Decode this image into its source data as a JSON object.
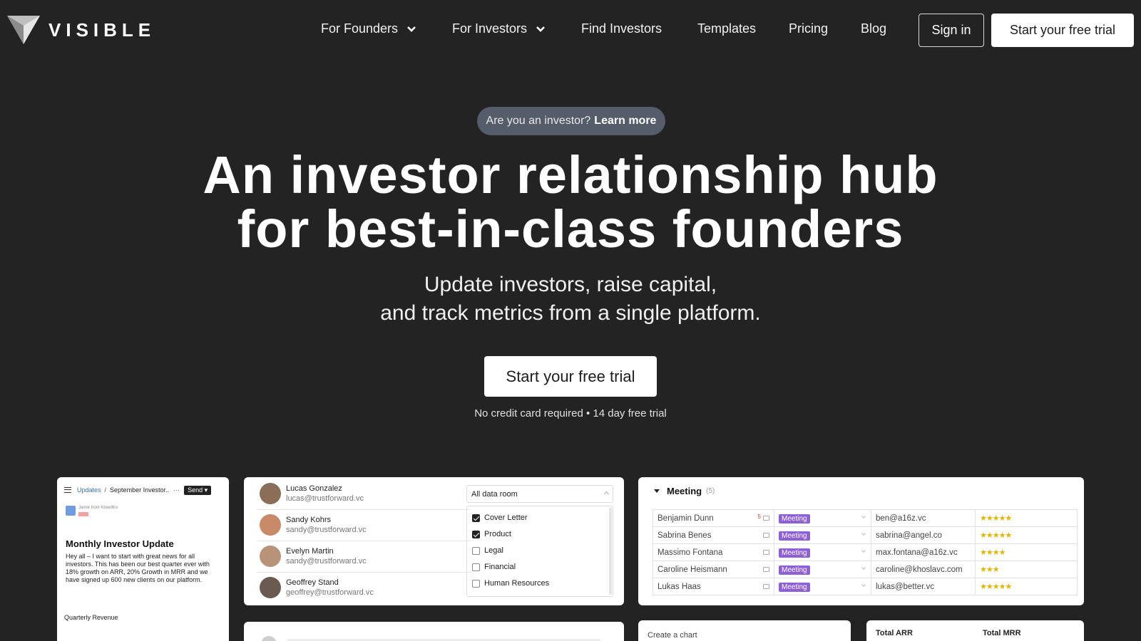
{
  "nav": {
    "logo_text": "VISIBLE",
    "links": [
      {
        "label": "For Founders",
        "has_dropdown": true
      },
      {
        "label": "For Investors",
        "has_dropdown": true
      },
      {
        "label": "Find Investors",
        "has_dropdown": false
      },
      {
        "label": "Templates",
        "has_dropdown": false
      },
      {
        "label": "Pricing",
        "has_dropdown": false
      },
      {
        "label": "Blog",
        "has_dropdown": false
      }
    ],
    "sign_in": "Sign in",
    "trial": "Start your free trial"
  },
  "hero": {
    "pill_text": "Are you an investor?",
    "pill_link": "Learn more",
    "title_line1": "An investor relationship hub",
    "title_line2": "for best-in-class founders",
    "sub_line1": "Update investors, raise capital,",
    "sub_line2": "and track metrics from a single platform.",
    "cta": "Start your free trial",
    "note": "No credit card required • 14 day free trial"
  },
  "update_card": {
    "crumb_link": "Updates",
    "crumb_sep": "/",
    "crumb_current": "September Investor..",
    "dots": "···",
    "send": "Send",
    "from": "Jamie from KlowdKo",
    "title": "Monthly Investor Update",
    "body": "Hey all – I want to start with great news for all investors. This has been our best quarter ever with 18% growth on ARR, 20% Growth in MRR and we have signed up 600 new clients on our platform.",
    "chart_title": "Quarterly Revenue"
  },
  "data_room": {
    "people": [
      {
        "name": "Lucas Gonzalez",
        "email": "lucas@trustforward.vc",
        "avatar_color": "#8a6e58"
      },
      {
        "name": "Sandy Kohrs",
        "email": "sandy@trustforward.vc",
        "avatar_color": "#c98a6a"
      },
      {
        "name": "Evelyn Martin",
        "email": "sandy@trustforward.vc",
        "avatar_color": "#b9927a"
      },
      {
        "name": "Geoffrey Stand",
        "email": "geoffrey@trustforward.vc",
        "avatar_color": "#6b5a50"
      }
    ],
    "select_value": "All data room",
    "options": [
      {
        "label": "Cover Letter",
        "checked": true
      },
      {
        "label": "Product",
        "checked": true
      },
      {
        "label": "Legal",
        "checked": false
      },
      {
        "label": "Financial",
        "checked": false
      },
      {
        "label": "Human Resources",
        "checked": false
      }
    ]
  },
  "pipeline": {
    "group": "Meeting",
    "count": "(5)",
    "rows": [
      {
        "name": "Benjamin Dunn",
        "badge": "5",
        "stage": "Meeting",
        "email": "ben@a16z.vc",
        "rating": 5
      },
      {
        "name": "Sabrina Benes",
        "badge": "",
        "stage": "Meeting",
        "email": "sabrina@angel.co",
        "rating": 5
      },
      {
        "name": "Massimo Fontana",
        "badge": "",
        "stage": "Meeting",
        "email": "max.fontana@a16z.vc",
        "rating": 4
      },
      {
        "name": "Caroline Heismann",
        "badge": "",
        "stage": "Meeting",
        "email": "caroline@khoslavc.com",
        "rating": 3
      },
      {
        "name": "Lukas Haas",
        "badge": "",
        "stage": "Meeting",
        "email": "lukas@better.vc",
        "rating": 5
      }
    ],
    "star_color": "#e3b500",
    "stage_color": "#8f5fd6"
  },
  "chart_card": {
    "label": "Create a chart"
  },
  "metrics_card": {
    "label1": "Total ARR",
    "label2": "Total MRR"
  },
  "colors": {
    "background": "#232323",
    "pill": "#555d6a",
    "button": "#ffffff"
  }
}
